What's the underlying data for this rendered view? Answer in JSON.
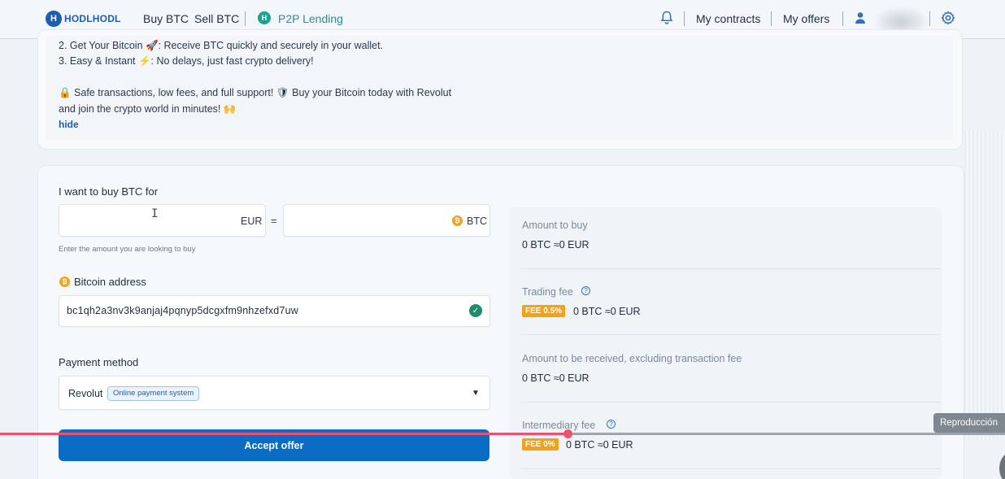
{
  "header": {
    "logo_text": "HODLHODL",
    "nav": {
      "buy": "Buy BTC",
      "sell": "Sell BTC",
      "lending": "P2P Lending"
    },
    "my_contracts": "My contracts",
    "my_offers": "My offers",
    "icons": [
      "bell-icon",
      "user-icon",
      "gear-icon"
    ]
  },
  "description": {
    "line2": "2. Get Your Bitcoin 🚀: Receive BTC quickly and securely in your wallet.",
    "line3": "3. Easy & Instant ⚡: No delays, just fast crypto delivery!",
    "line4": "🔒 Safe transactions, low fees, and full support! 🛡 Buy your Bitcoin today with Revolut",
    "line5": "and join the crypto world in minutes! 🙌",
    "hide": "hide"
  },
  "order": {
    "buy_label": "I want to buy BTC for",
    "fiat_currency": "EUR",
    "equals": "=",
    "crypto_currency": "BTC",
    "hint": "Enter the amount you are looking to buy",
    "address_label": "Bitcoin address",
    "address_value": "bc1qh2a3nv3k9anjaj4pqnyp5dcgxfm9nhzefxd7uw",
    "payment_label": "Payment method",
    "payment_value": "Revolut",
    "payment_tag": "Online payment system",
    "accept": "Accept offer"
  },
  "summary": {
    "amount_to_buy": {
      "title": "Amount to buy",
      "value": "0 BTC ≈0 EUR"
    },
    "trading_fee": {
      "title": "Trading fee",
      "badge": "FEE 0.5%",
      "value": "0 BTC ≈0 EUR"
    },
    "amount_received": {
      "title": "Amount to be received, excluding transaction fee",
      "value": "0 BTC ≈0 EUR"
    },
    "intermediary_fee": {
      "title": "Intermediary fee",
      "badge": "FEE 0%",
      "value": "0 BTC ≈0 EUR"
    }
  },
  "video_overlay": {
    "tooltip": "Reproducción",
    "progress": 0.565,
    "colors": {
      "played": "#f0506e",
      "rest": "#9ea4a9"
    }
  },
  "colors": {
    "brand": "#1c5fb2",
    "button": "#0b6cc4",
    "fee_badge": "#f0a21d",
    "bitcoin": "#f2a31b",
    "success": "#1f8a6f"
  }
}
